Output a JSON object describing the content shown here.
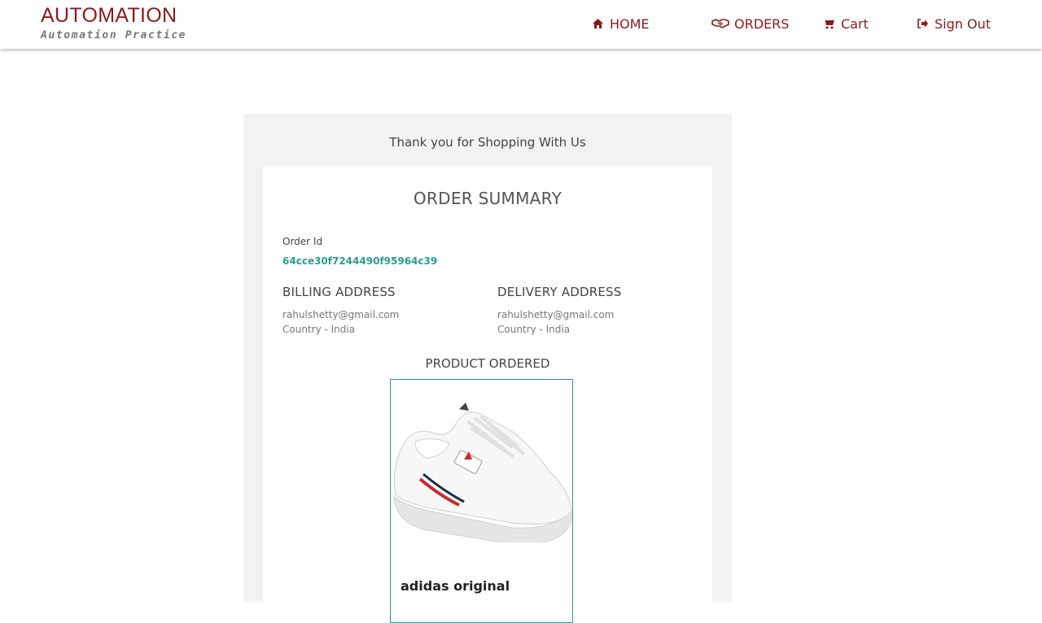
{
  "header": {
    "brand_title": "AUTOMATION",
    "brand_subtitle": "Automation Practice",
    "nav": {
      "home": "HOME",
      "orders": "ORDERS",
      "cart": "Cart",
      "sign_out": "Sign Out"
    }
  },
  "order": {
    "thank_you": "Thank you for Shopping With Us",
    "summary_title": "ORDER SUMMARY",
    "order_id_label": "Order Id",
    "order_id": "64cce30f7244490f95964c39",
    "billing": {
      "title": "BILLING ADDRESS",
      "email": "rahulshetty@gmail.com",
      "country": "Country - India"
    },
    "delivery": {
      "title": "DELIVERY ADDRESS",
      "email": "rahulshetty@gmail.com",
      "country": "Country - India"
    },
    "product_heading": "PRODUCT ORDERED",
    "product": {
      "name": "adidas original",
      "image_icon": "sneaker-image"
    }
  },
  "colors": {
    "brand": "#8b1a1a",
    "accent": "#2a9d8f",
    "panel_bg": "#f2f2f2"
  }
}
